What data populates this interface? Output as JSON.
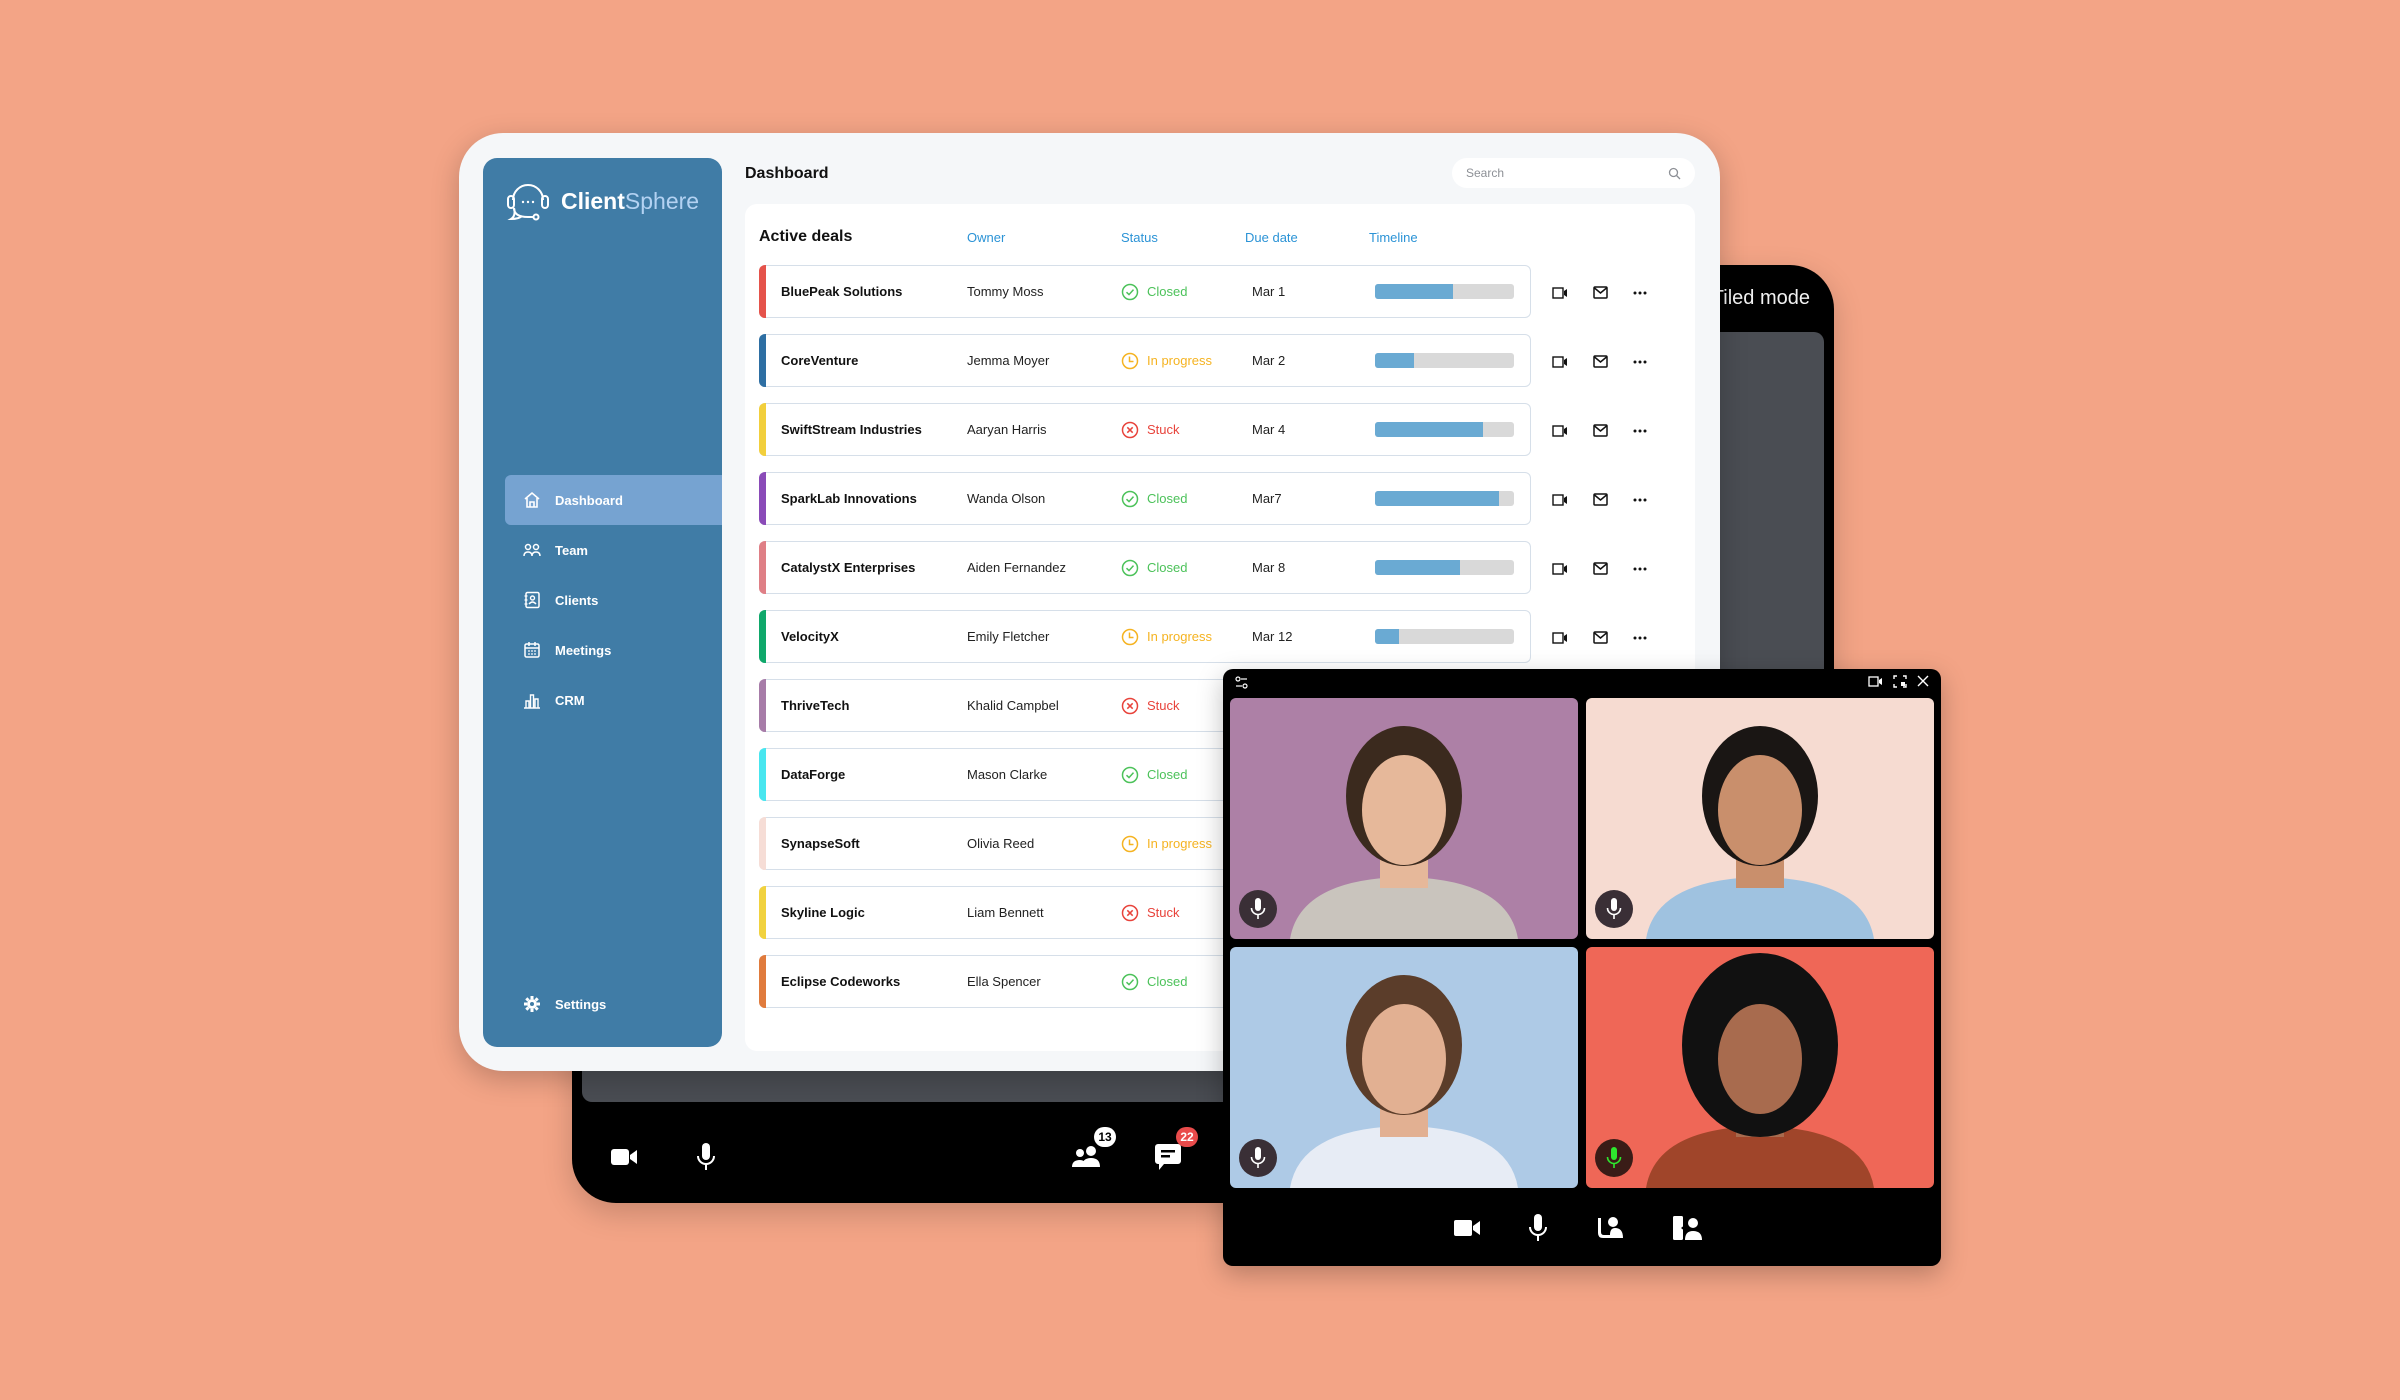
{
  "brand": {
    "name_bold": "Client",
    "name_light": "Sphere"
  },
  "sidebar": {
    "items": [
      {
        "label": "Dashboard",
        "icon": "home-icon",
        "active": true
      },
      {
        "label": "Team",
        "icon": "team-icon",
        "active": false
      },
      {
        "label": "Clients",
        "icon": "contacts-icon",
        "active": false
      },
      {
        "label": "Meetings",
        "icon": "calendar-icon",
        "active": false
      },
      {
        "label": "CRM",
        "icon": "bar-chart-icon",
        "active": false
      }
    ],
    "settings": {
      "label": "Settings",
      "icon": "gear-icon"
    }
  },
  "header": {
    "title": "Dashboard",
    "search": {
      "placeholder": "Search",
      "value": ""
    }
  },
  "deals": {
    "title": "Active deals",
    "columns": {
      "owner": "Owner",
      "status": "Status",
      "due": "Due date",
      "timeline": "Timeline"
    },
    "status_colors": {
      "Closed": "#4cc25a",
      "In progress": "#f5b321",
      "Stuck": "#e8433b"
    },
    "rows": [
      {
        "name": "BluePeak Solutions",
        "owner": "Tommy Moss",
        "status": "Closed",
        "due": "Mar 1",
        "progress": 0.56,
        "color": "#e5534b"
      },
      {
        "name": "CoreVenture",
        "owner": "Jemma Moyer",
        "status": "In progress",
        "due": "Mar 2",
        "progress": 0.28,
        "color": "#2e6fa3"
      },
      {
        "name": "SwiftStream Industries",
        "owner": "Aaryan Harris",
        "status": "Stuck",
        "due": "Mar 4",
        "progress": 0.78,
        "color": "#f2cf3c"
      },
      {
        "name": "SparkLab Innovations",
        "owner": "Wanda Olson",
        "status": "Closed",
        "due": "Mar7",
        "progress": 0.89,
        "color": "#8a4bb8"
      },
      {
        "name": "CatalystX Enterprises",
        "owner": "Aiden Fernandez",
        "status": "Closed",
        "due": "Mar 8",
        "progress": 0.61,
        "color": "#df7f86"
      },
      {
        "name": "VelocityX",
        "owner": "Emily Fletcher",
        "status": "In progress",
        "due": "Mar 12",
        "progress": 0.17,
        "color": "#0fa86b"
      },
      {
        "name": "ThriveTech",
        "owner": "Khalid Campbel",
        "status": "Stuck",
        "due": "",
        "progress": null,
        "color": "#a77ca8"
      },
      {
        "name": "DataForge",
        "owner": "Mason Clarke",
        "status": "Closed",
        "due": "",
        "progress": null,
        "color": "#48e6ef"
      },
      {
        "name": "SynapseSoft",
        "owner": "Olivia Reed",
        "status": "In progress",
        "due": "",
        "progress": null,
        "color": "#f6ddd6"
      },
      {
        "name": "Skyline Logic",
        "owner": "Liam Bennett",
        "status": "Stuck",
        "due": "",
        "progress": null,
        "color": "#f1d23f"
      },
      {
        "name": "Eclipse Codeworks",
        "owner": "Ella Spencer",
        "status": "Closed",
        "due": "",
        "progress": null,
        "color": "#e07b3d"
      }
    ],
    "actions": [
      "video-call-icon",
      "mail-icon",
      "more-icon"
    ]
  },
  "call_window": {
    "mode_label": "Tiled mode",
    "participants_count": "13",
    "messages_count": "22"
  },
  "video_popup": {
    "tiles": [
      {
        "bg": "#ad80a6",
        "mic_active": false
      },
      {
        "bg": "#f6dbd1",
        "mic_active": false
      },
      {
        "bg": "#aecae6",
        "mic_active": false
      },
      {
        "bg": "#ef6757",
        "mic_active": true
      }
    ]
  }
}
